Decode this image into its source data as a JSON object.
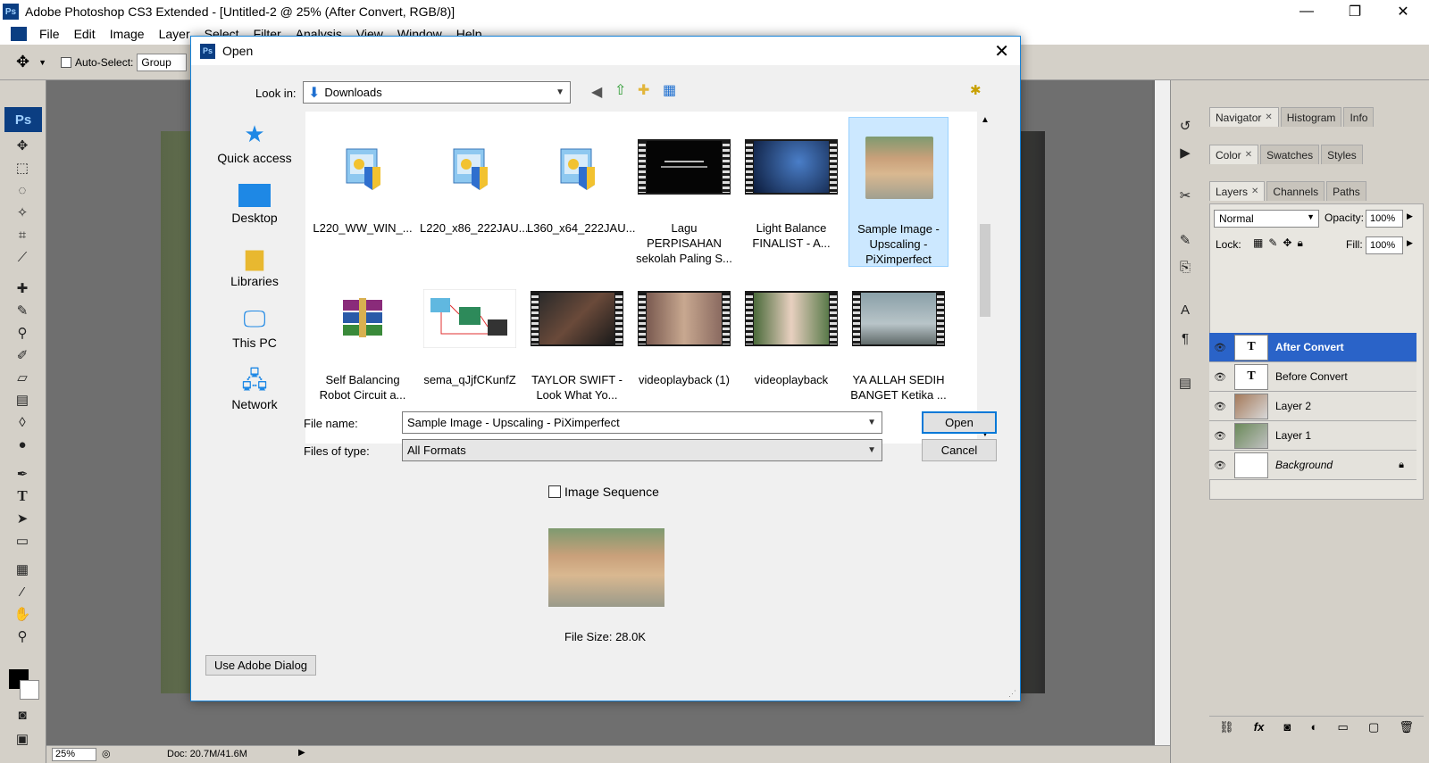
{
  "app": {
    "title": "Adobe Photoshop CS3 Extended - [Untitled-2 @ 25% (After Convert, RGB/8)]",
    "logo": "Ps",
    "menu": [
      "File",
      "Edit",
      "Image",
      "Layer",
      "Select",
      "Filter",
      "Analysis",
      "View",
      "Window",
      "Help"
    ],
    "window_controls": {
      "minimize": "—",
      "restore": "❐",
      "close": "✕"
    }
  },
  "options_bar": {
    "auto_select_label": "Auto-Select:",
    "auto_select_value": "Group"
  },
  "status_bar": {
    "zoom": "25%",
    "doc": "Doc: 20.7M/41.6M"
  },
  "panels": {
    "group1_tabs": [
      "Navigator",
      "Histogram",
      "Info"
    ],
    "group2_tabs": [
      "Color",
      "Swatches",
      "Styles"
    ],
    "group3_tabs": [
      "Layers",
      "Channels",
      "Paths"
    ],
    "blend_mode": "Normal",
    "opacity_label": "Opacity:",
    "opacity_value": "100%",
    "lock_label": "Lock:",
    "fill_label": "Fill:",
    "fill_value": "100%",
    "layers": [
      {
        "name": "After Convert",
        "type": "text",
        "selected": true
      },
      {
        "name": "Before Convert",
        "type": "text",
        "selected": false
      },
      {
        "name": "Layer 2",
        "type": "image",
        "selected": false
      },
      {
        "name": "Layer 1",
        "type": "image",
        "selected": false
      },
      {
        "name": "Background",
        "type": "background",
        "selected": false
      }
    ]
  },
  "dialog": {
    "title": "Open",
    "logo": "Ps",
    "look_in_label": "Look in:",
    "look_in_value": "Downloads",
    "places": [
      "Quick access",
      "Desktop",
      "Libraries",
      "This PC",
      "Network"
    ],
    "files": [
      {
        "name": "L220_WW_WIN_...",
        "kind": "installer"
      },
      {
        "name": "L220_x86_222JAU...",
        "kind": "installer"
      },
      {
        "name": "L360_x64_222JAU...",
        "kind": "installer"
      },
      {
        "name": "Lagu PERPISAHAN sekolah Paling S...",
        "kind": "video-dark"
      },
      {
        "name": "Light Balance FINALIST - A...",
        "kind": "video-blue"
      },
      {
        "name": "Sample Image - Upscaling - PiXimperfect",
        "kind": "image",
        "selected": true
      },
      {
        "name": "Self Balancing Robot Circuit a...",
        "kind": "archive"
      },
      {
        "name": "sema_qJjfCKunfZ",
        "kind": "diagram"
      },
      {
        "name": "TAYLOR SWIFT - Look What Yo...",
        "kind": "video-dance"
      },
      {
        "name": "videoplayback (1)",
        "kind": "video-people"
      },
      {
        "name": "videoplayback",
        "kind": "video-girl"
      },
      {
        "name": "YA ALLAH SEDIH BANGET Ketika ...",
        "kind": "video-street"
      }
    ],
    "file_name_label": "File name:",
    "file_name_value": "Sample Image - Upscaling - PiXimperfect",
    "files_of_type_label": "Files of type:",
    "files_of_type_value": "All Formats",
    "open_button": "Open",
    "cancel_button": "Cancel",
    "image_sequence_label": "Image Sequence",
    "file_size": "File Size: 28.0K",
    "use_adobe_dialog_button": "Use Adobe Dialog"
  },
  "colors": {
    "accent": "#0078d7",
    "selection": "#cce8ff",
    "layer_selected": "#2a63c8",
    "ps_blue": "#0b3e82"
  }
}
